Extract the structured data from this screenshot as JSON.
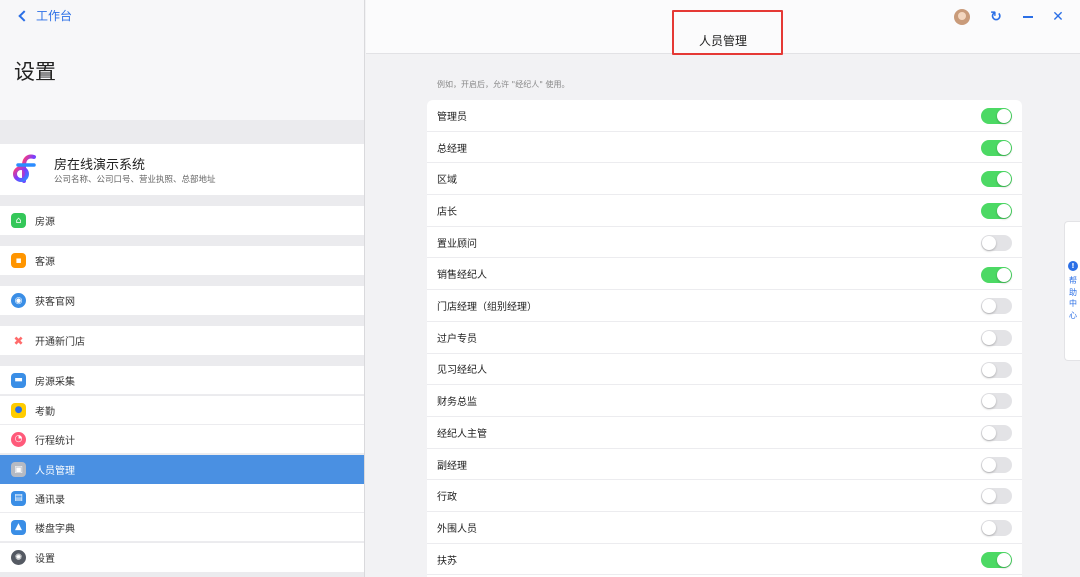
{
  "left": {
    "back_label": "工作台",
    "title": "设置",
    "company": {
      "name": "房在线演示系统",
      "subtitle": "公司名称、公司口号、营业执照、总部地址"
    },
    "menu": [
      {
        "label": "房源",
        "icon": "house-icon",
        "color": "#34c759"
      },
      {
        "label": "客源",
        "icon": "people-icon",
        "color": "#ff9500"
      },
      {
        "label": "获客官网",
        "icon": "globe-icon",
        "color": "#3a8ee6"
      },
      {
        "label": "开通新门店",
        "icon": "pinwheel-icon",
        "color": "#ff6b6b"
      },
      {
        "label": "房源采集",
        "icon": "folder-icon",
        "color": "#3a8ee6"
      },
      {
        "label": "考勤",
        "icon": "map-pin-icon",
        "color": "#ffcc00"
      },
      {
        "label": "行程统计",
        "icon": "chart-icon",
        "color": "#ff5a7a"
      },
      {
        "label": "人员管理",
        "icon": "person-card-icon",
        "color": "#b5bac3"
      },
      {
        "label": "通讯录",
        "icon": "contacts-icon",
        "color": "#3a8ee6"
      },
      {
        "label": "楼盘字典",
        "icon": "building-icon",
        "color": "#3a8ee6"
      },
      {
        "label": "设置",
        "icon": "gear-icon",
        "color": "#555a63"
      }
    ]
  },
  "right": {
    "title": "人员管理",
    "hint": "例如，开启后，允许 \"经纪人\" 使用。",
    "help_label": "帮助中心",
    "rows": [
      {
        "label": "管理员",
        "on": true
      },
      {
        "label": "总经理",
        "on": true
      },
      {
        "label": "区域",
        "on": true
      },
      {
        "label": "店长",
        "on": true
      },
      {
        "label": "置业顾问",
        "on": false
      },
      {
        "label": "销售经纪人",
        "on": true
      },
      {
        "label": "门店经理（组别经理）",
        "on": false
      },
      {
        "label": "过户专员",
        "on": false
      },
      {
        "label": "见习经纪人",
        "on": false
      },
      {
        "label": "财务总监",
        "on": false
      },
      {
        "label": "经纪人主管",
        "on": false
      },
      {
        "label": "副经理",
        "on": false
      },
      {
        "label": "行政",
        "on": false
      },
      {
        "label": "外围人员",
        "on": false
      },
      {
        "label": "扶苏",
        "on": true
      }
    ]
  },
  "colors": {
    "accent": "#2b6fe6",
    "toggle_on": "#4cd964",
    "toggle_off": "#e3e3e6",
    "active_item": "#4a90e2",
    "highlight_box": "#e53935"
  }
}
